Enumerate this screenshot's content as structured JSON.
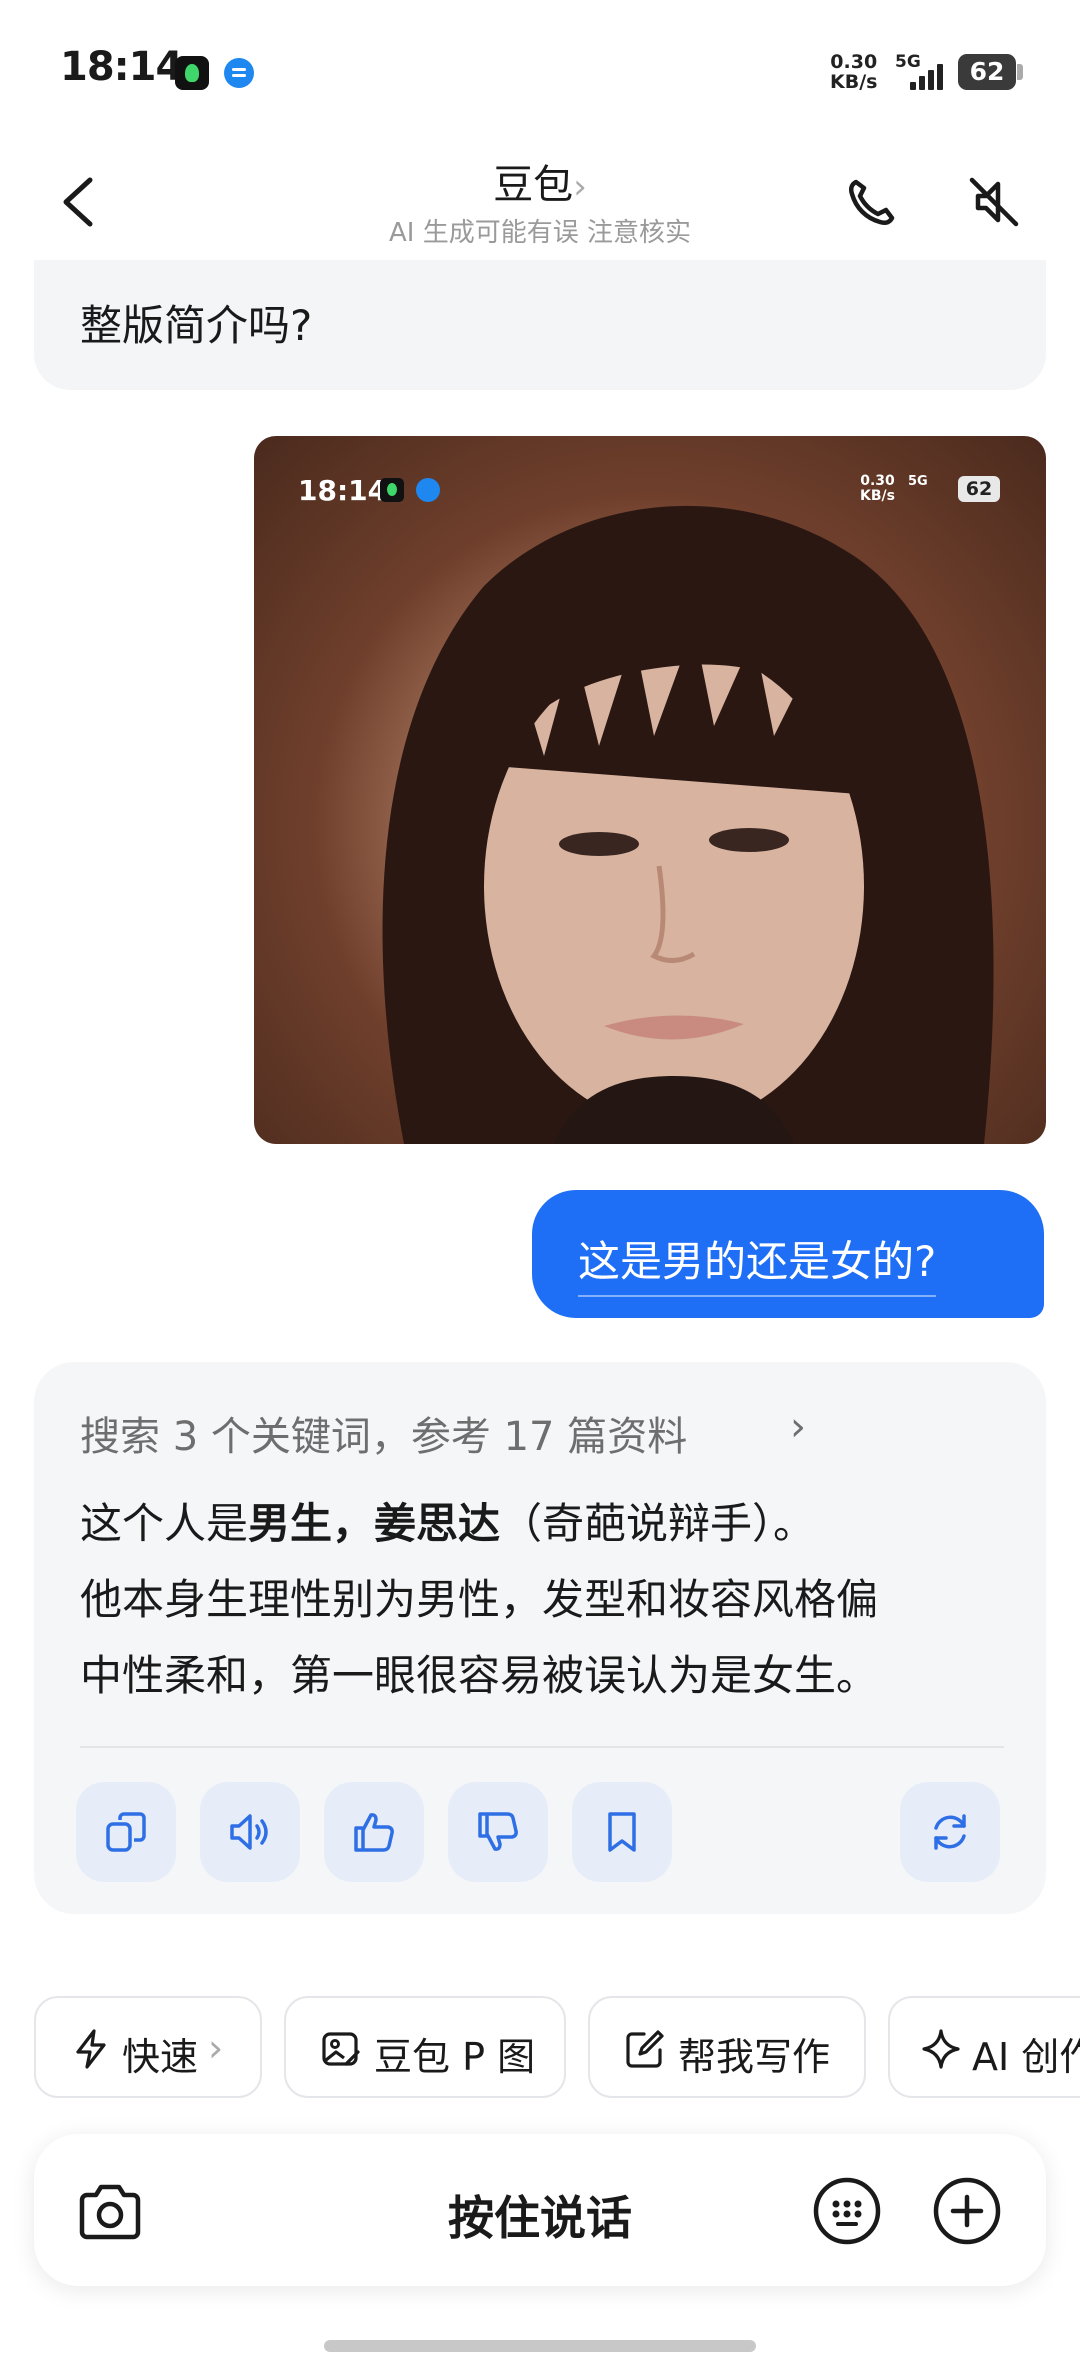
{
  "status_bar": {
    "time": "18:14",
    "speed_value": "0.30",
    "speed_unit": "KB/s",
    "network": "5G",
    "battery": "62",
    "icons": [
      "music-app-icon",
      "message-app-icon",
      "signal-icon",
      "battery-icon"
    ]
  },
  "header": {
    "title": "豆包",
    "title_chevron": "›",
    "subtitle": "AI 生成可能有误 注意核实",
    "icons": [
      "back-icon",
      "phone-icon",
      "speaker-muted-icon"
    ]
  },
  "conversation": {
    "previous_bot_tail": "整版简介吗?",
    "image_overlay": {
      "time": "18:14",
      "speed_value": "0.30",
      "speed_unit": "KB/s",
      "network": "5G",
      "battery": "62"
    },
    "user_message": "这是男的还是女的?",
    "ai_answer": {
      "search_summary": "搜索 3 个关键词，参考 17 篇资料",
      "search_chevron": "›",
      "line1_plain": "这个人是",
      "line1_bold": "男生，姜思达",
      "line1_tail": "（奇葩说辩手）。",
      "line2": "他本身生理性别为男性，发型和妆容风格偏",
      "line3": "中性柔和，第一眼很容易被误认为是女生。",
      "actions": [
        "copy-icon",
        "speaker-icon",
        "thumbs-up-icon",
        "thumbs-down-icon",
        "bookmark-icon",
        "regenerate-icon"
      ]
    }
  },
  "quick_chips": [
    {
      "label": "快速",
      "chevron": "›",
      "icon": "lightning-icon"
    },
    {
      "label": "豆包 P 图",
      "icon": "photo-edit-icon"
    },
    {
      "label": "帮我写作",
      "icon": "edit-icon"
    },
    {
      "label": "AI 创作",
      "icon": "sparkle-icon"
    }
  ],
  "input_bar": {
    "hold_to_talk": "按住说话",
    "icons": [
      "camera-icon",
      "keyboard-icon",
      "plus-icon"
    ]
  },
  "colors": {
    "accent_blue": "#1e6ff5",
    "bubble_gray": "#f5f6f8",
    "action_bg": "#e7edf8",
    "action_icon": "#2f6fe6"
  }
}
